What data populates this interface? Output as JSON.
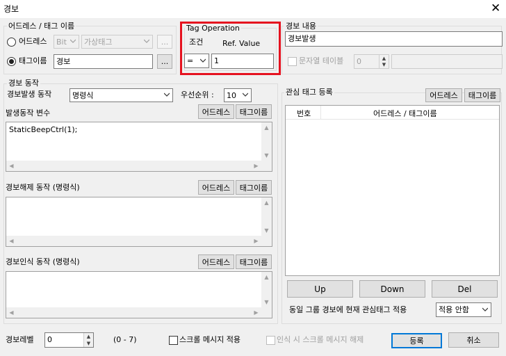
{
  "window": {
    "title": "경보",
    "close_glyph": "✕"
  },
  "address_group": {
    "legend": "어드레스 / 태그 이름",
    "address_radio_label": "어드레스",
    "bit_select": "Bit",
    "virtual_tag_select": "가상태그",
    "browse_label": "...",
    "tagname_radio_label": "태그이름",
    "tagname_value": "경보"
  },
  "tag_operation": {
    "legend": "Tag Operation",
    "condition_label": "조건",
    "ref_label": "Ref. Value",
    "operator": "=",
    "ref_value": "1"
  },
  "alarm_content": {
    "legend": "경보 내용",
    "text_value": "경보발생",
    "string_table_label": "문자열 테이블",
    "string_table_value": "0"
  },
  "alarm_action": {
    "legend": "경보 동작",
    "trigger_label": "경보발생 동작",
    "trigger_select": "명령식",
    "priority_label": "우선순위 :",
    "priority_value": "10",
    "var_label": "발생동작 변수",
    "address_btn": "어드레스",
    "tagname_btn": "태그이름",
    "script_text": "StaticBeepCtrl(1);",
    "release_label": "경보해제 동작 (명령식)",
    "ack_label": "경보인식 동작 (명령식)"
  },
  "watch_tags": {
    "legend": "관심 태그 등록",
    "address_btn": "어드레스",
    "tagname_btn": "태그이름",
    "columns": [
      "번호",
      "어드레스 / 태그이름"
    ],
    "up_btn": "Up",
    "down_btn": "Down",
    "del_btn": "Del",
    "apply_label": "동일 그룹 경보에 현재 관심태그 적용",
    "apply_select": "적용 안함"
  },
  "footer": {
    "level_label": "경보레벨",
    "level_value": "0",
    "range_label": "(0 - 7)",
    "scroll_msg_label": "스크롤 메시지 적용",
    "ack_scroll_label": "인식 시 스크롤 메시지 해제",
    "register_btn": "등록",
    "cancel_btn": "취소"
  },
  "colors": {
    "highlight": "#e5121f",
    "accent": "#0078d7"
  },
  "icons": [
    "close-icon",
    "chevron-down-icon",
    "scroll-up-icon",
    "scroll-down-icon",
    "scroll-left-icon",
    "scroll-right-icon",
    "spin-up-icon",
    "spin-down-icon"
  ]
}
